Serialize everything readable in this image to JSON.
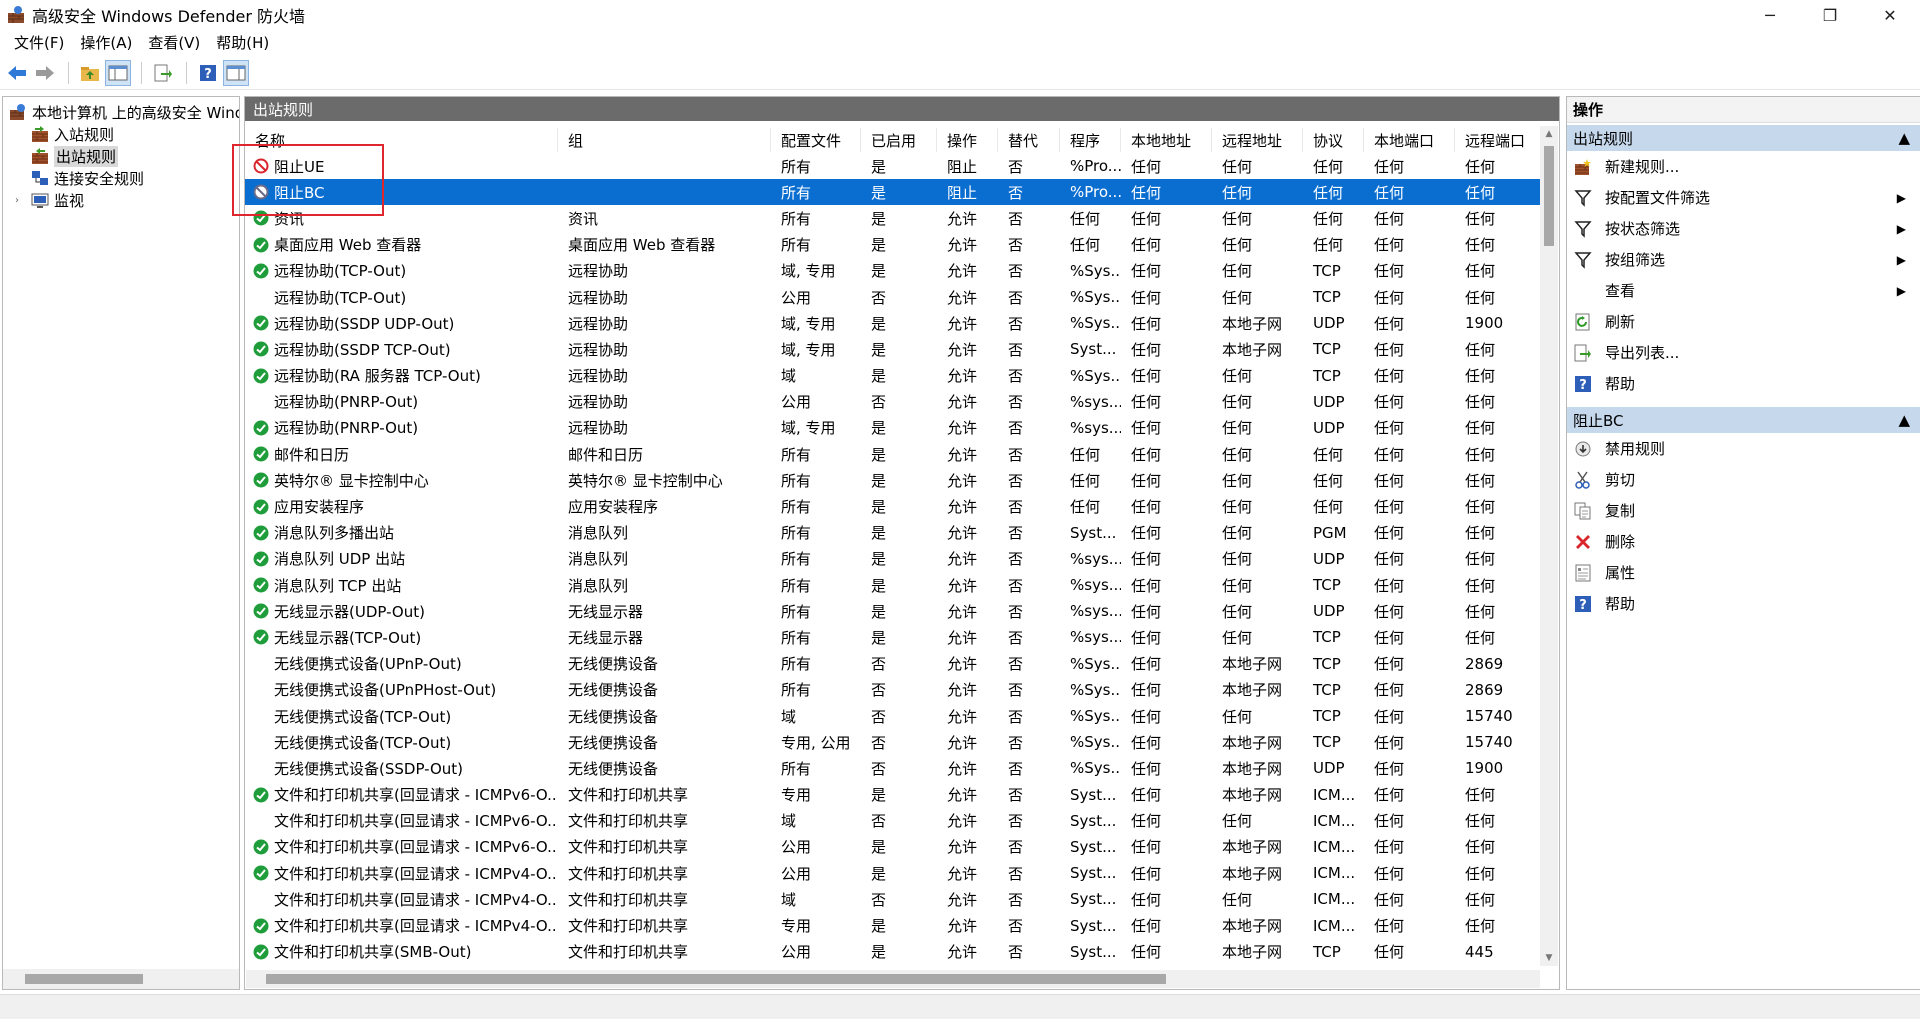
{
  "window": {
    "title": "高级安全 Windows Defender 防火墙",
    "minimize": "─",
    "maximize": "❐",
    "close": "✕"
  },
  "menu": [
    "文件(F)",
    "操作(A)",
    "查看(V)",
    "帮助(H)"
  ],
  "tree": {
    "root": "本地计算机 上的高级安全 Windows Defender 防火墙",
    "items": [
      "入站规则",
      "出站规则",
      "连接安全规则",
      "监视"
    ],
    "selected": "出站规则"
  },
  "main": {
    "section_title": "出站规则",
    "columns": [
      "名称",
      "组",
      "配置文件",
      "已启用",
      "操作",
      "替代",
      "程序",
      "本地地址",
      "远程地址",
      "协议",
      "本地端口",
      "远程端口"
    ],
    "rows": [
      {
        "icon": "block",
        "name": "阻止UE",
        "group": "",
        "profile": "所有",
        "enabled": "是",
        "action": "阻止",
        "override": "否",
        "program": "%Pro...",
        "local": "任何",
        "remote": "任何",
        "protocol": "任何",
        "lport": "任何",
        "rport": "任何"
      },
      {
        "icon": "block-disabled",
        "name": "阻止BC",
        "group": "",
        "profile": "所有",
        "enabled": "是",
        "action": "阻止",
        "override": "否",
        "program": "%Pro...",
        "local": "任何",
        "remote": "任何",
        "protocol": "任何",
        "lport": "任何",
        "rport": "任何",
        "selected": true
      },
      {
        "icon": "allow",
        "name": "资讯",
        "group": "资讯",
        "profile": "所有",
        "enabled": "是",
        "action": "允许",
        "override": "否",
        "program": "任何",
        "local": "任何",
        "remote": "任何",
        "protocol": "任何",
        "lport": "任何",
        "rport": "任何"
      },
      {
        "icon": "allow",
        "name": "桌面应用 Web 查看器",
        "group": "桌面应用 Web 查看器",
        "profile": "所有",
        "enabled": "是",
        "action": "允许",
        "override": "否",
        "program": "任何",
        "local": "任何",
        "remote": "任何",
        "protocol": "任何",
        "lport": "任何",
        "rport": "任何"
      },
      {
        "icon": "allow",
        "name": "远程协助(TCP-Out)",
        "group": "远程协助",
        "profile": "域, 专用",
        "enabled": "是",
        "action": "允许",
        "override": "否",
        "program": "%Sys...",
        "local": "任何",
        "remote": "任何",
        "protocol": "TCP",
        "lport": "任何",
        "rport": "任何"
      },
      {
        "icon": "none",
        "name": "远程协助(TCP-Out)",
        "group": "远程协助",
        "profile": "公用",
        "enabled": "否",
        "action": "允许",
        "override": "否",
        "program": "%Sys...",
        "local": "任何",
        "remote": "任何",
        "protocol": "TCP",
        "lport": "任何",
        "rport": "任何"
      },
      {
        "icon": "allow",
        "name": "远程协助(SSDP UDP-Out)",
        "group": "远程协助",
        "profile": "域, 专用",
        "enabled": "是",
        "action": "允许",
        "override": "否",
        "program": "%Sys...",
        "local": "任何",
        "remote": "本地子网",
        "protocol": "UDP",
        "lport": "任何",
        "rport": "1900"
      },
      {
        "icon": "allow",
        "name": "远程协助(SSDP TCP-Out)",
        "group": "远程协助",
        "profile": "域, 专用",
        "enabled": "是",
        "action": "允许",
        "override": "否",
        "program": "Syst...",
        "local": "任何",
        "remote": "本地子网",
        "protocol": "TCP",
        "lport": "任何",
        "rport": "任何"
      },
      {
        "icon": "allow",
        "name": "远程协助(RA 服务器 TCP-Out)",
        "group": "远程协助",
        "profile": "域",
        "enabled": "是",
        "action": "允许",
        "override": "否",
        "program": "%Sys...",
        "local": "任何",
        "remote": "任何",
        "protocol": "TCP",
        "lport": "任何",
        "rport": "任何"
      },
      {
        "icon": "none",
        "name": "远程协助(PNRP-Out)",
        "group": "远程协助",
        "profile": "公用",
        "enabled": "否",
        "action": "允许",
        "override": "否",
        "program": "%sys...",
        "local": "任何",
        "remote": "任何",
        "protocol": "UDP",
        "lport": "任何",
        "rport": "任何"
      },
      {
        "icon": "allow",
        "name": "远程协助(PNRP-Out)",
        "group": "远程协助",
        "profile": "域, 专用",
        "enabled": "是",
        "action": "允许",
        "override": "否",
        "program": "%sys...",
        "local": "任何",
        "remote": "任何",
        "protocol": "UDP",
        "lport": "任何",
        "rport": "任何"
      },
      {
        "icon": "allow",
        "name": "邮件和日历",
        "group": "邮件和日历",
        "profile": "所有",
        "enabled": "是",
        "action": "允许",
        "override": "否",
        "program": "任何",
        "local": "任何",
        "remote": "任何",
        "protocol": "任何",
        "lport": "任何",
        "rport": "任何"
      },
      {
        "icon": "allow",
        "name": "英特尔® 显卡控制中心",
        "group": "英特尔® 显卡控制中心",
        "profile": "所有",
        "enabled": "是",
        "action": "允许",
        "override": "否",
        "program": "任何",
        "local": "任何",
        "remote": "任何",
        "protocol": "任何",
        "lport": "任何",
        "rport": "任何"
      },
      {
        "icon": "allow",
        "name": "应用安装程序",
        "group": "应用安装程序",
        "profile": "所有",
        "enabled": "是",
        "action": "允许",
        "override": "否",
        "program": "任何",
        "local": "任何",
        "remote": "任何",
        "protocol": "任何",
        "lport": "任何",
        "rport": "任何"
      },
      {
        "icon": "allow",
        "name": "消息队列多播出站",
        "group": "消息队列",
        "profile": "所有",
        "enabled": "是",
        "action": "允许",
        "override": "否",
        "program": "Syst...",
        "local": "任何",
        "remote": "任何",
        "protocol": "PGM",
        "lport": "任何",
        "rport": "任何"
      },
      {
        "icon": "allow",
        "name": "消息队列 UDP 出站",
        "group": "消息队列",
        "profile": "所有",
        "enabled": "是",
        "action": "允许",
        "override": "否",
        "program": "%sys...",
        "local": "任何",
        "remote": "任何",
        "protocol": "UDP",
        "lport": "任何",
        "rport": "任何"
      },
      {
        "icon": "allow",
        "name": "消息队列 TCP 出站",
        "group": "消息队列",
        "profile": "所有",
        "enabled": "是",
        "action": "允许",
        "override": "否",
        "program": "%sys...",
        "local": "任何",
        "remote": "任何",
        "protocol": "TCP",
        "lport": "任何",
        "rport": "任何"
      },
      {
        "icon": "allow",
        "name": "无线显示器(UDP-Out)",
        "group": "无线显示器",
        "profile": "所有",
        "enabled": "是",
        "action": "允许",
        "override": "否",
        "program": "%sys...",
        "local": "任何",
        "remote": "任何",
        "protocol": "UDP",
        "lport": "任何",
        "rport": "任何"
      },
      {
        "icon": "allow",
        "name": "无线显示器(TCP-Out)",
        "group": "无线显示器",
        "profile": "所有",
        "enabled": "是",
        "action": "允许",
        "override": "否",
        "program": "%sys...",
        "local": "任何",
        "remote": "任何",
        "protocol": "TCP",
        "lport": "任何",
        "rport": "任何"
      },
      {
        "icon": "none",
        "name": "无线便携式设备(UPnP-Out)",
        "group": "无线便携设备",
        "profile": "所有",
        "enabled": "否",
        "action": "允许",
        "override": "否",
        "program": "%Sys...",
        "local": "任何",
        "remote": "本地子网",
        "protocol": "TCP",
        "lport": "任何",
        "rport": "2869"
      },
      {
        "icon": "none",
        "name": "无线便携式设备(UPnPHost-Out)",
        "group": "无线便携设备",
        "profile": "所有",
        "enabled": "否",
        "action": "允许",
        "override": "否",
        "program": "%Sys...",
        "local": "任何",
        "remote": "本地子网",
        "protocol": "TCP",
        "lport": "任何",
        "rport": "2869"
      },
      {
        "icon": "none",
        "name": "无线便携式设备(TCP-Out)",
        "group": "无线便携设备",
        "profile": "域",
        "enabled": "否",
        "action": "允许",
        "override": "否",
        "program": "%Sys...",
        "local": "任何",
        "remote": "任何",
        "protocol": "TCP",
        "lport": "任何",
        "rport": "15740"
      },
      {
        "icon": "none",
        "name": "无线便携式设备(TCP-Out)",
        "group": "无线便携设备",
        "profile": "专用, 公用",
        "enabled": "否",
        "action": "允许",
        "override": "否",
        "program": "%Sys...",
        "local": "任何",
        "remote": "本地子网",
        "protocol": "TCP",
        "lport": "任何",
        "rport": "15740"
      },
      {
        "icon": "none",
        "name": "无线便携式设备(SSDP-Out)",
        "group": "无线便携设备",
        "profile": "所有",
        "enabled": "否",
        "action": "允许",
        "override": "否",
        "program": "%Sys...",
        "local": "任何",
        "remote": "本地子网",
        "protocol": "UDP",
        "lport": "任何",
        "rport": "1900"
      },
      {
        "icon": "allow",
        "name": "文件和打印机共享(回显请求 - ICMPv6-O...",
        "group": "文件和打印机共享",
        "profile": "专用",
        "enabled": "是",
        "action": "允许",
        "override": "否",
        "program": "Syst...",
        "local": "任何",
        "remote": "本地子网",
        "protocol": "ICM...",
        "lport": "任何",
        "rport": "任何"
      },
      {
        "icon": "none",
        "name": "文件和打印机共享(回显请求 - ICMPv6-O...",
        "group": "文件和打印机共享",
        "profile": "域",
        "enabled": "否",
        "action": "允许",
        "override": "否",
        "program": "Syst...",
        "local": "任何",
        "remote": "任何",
        "protocol": "ICM...",
        "lport": "任何",
        "rport": "任何"
      },
      {
        "icon": "allow",
        "name": "文件和打印机共享(回显请求 - ICMPv6-O...",
        "group": "文件和打印机共享",
        "profile": "公用",
        "enabled": "是",
        "action": "允许",
        "override": "否",
        "program": "Syst...",
        "local": "任何",
        "remote": "本地子网",
        "protocol": "ICM...",
        "lport": "任何",
        "rport": "任何"
      },
      {
        "icon": "allow",
        "name": "文件和打印机共享(回显请求 - ICMPv4-O...",
        "group": "文件和打印机共享",
        "profile": "公用",
        "enabled": "是",
        "action": "允许",
        "override": "否",
        "program": "Syst...",
        "local": "任何",
        "remote": "本地子网",
        "protocol": "ICM...",
        "lport": "任何",
        "rport": "任何"
      },
      {
        "icon": "none",
        "name": "文件和打印机共享(回显请求 - ICMPv4-O...",
        "group": "文件和打印机共享",
        "profile": "域",
        "enabled": "否",
        "action": "允许",
        "override": "否",
        "program": "Syst...",
        "local": "任何",
        "remote": "任何",
        "protocol": "ICM...",
        "lport": "任何",
        "rport": "任何"
      },
      {
        "icon": "allow",
        "name": "文件和打印机共享(回显请求 - ICMPv4-O...",
        "group": "文件和打印机共享",
        "profile": "专用",
        "enabled": "是",
        "action": "允许",
        "override": "否",
        "program": "Syst...",
        "local": "任何",
        "remote": "本地子网",
        "protocol": "ICM...",
        "lport": "任何",
        "rport": "任何"
      },
      {
        "icon": "allow",
        "name": "文件和打印机共享(SMB-Out)",
        "group": "文件和打印机共享",
        "profile": "公用",
        "enabled": "是",
        "action": "允许",
        "override": "否",
        "program": "Syst...",
        "local": "任何",
        "remote": "本地子网",
        "protocol": "TCP",
        "lport": "任何",
        "rport": "445"
      }
    ]
  },
  "actions": {
    "title": "操作",
    "groups": [
      {
        "title": "出站规则",
        "items": [
          {
            "label": "新建规则...",
            "icon": "new-rule-icon",
            "submenu": false
          },
          {
            "label": "按配置文件筛选",
            "icon": "filter-icon",
            "submenu": true
          },
          {
            "label": "按状态筛选",
            "icon": "filter-icon",
            "submenu": true
          },
          {
            "label": "按组筛选",
            "icon": "filter-icon",
            "submenu": true
          },
          {
            "label": "查看",
            "icon": "",
            "submenu": true
          },
          {
            "label": "刷新",
            "icon": "refresh-icon",
            "submenu": false
          },
          {
            "label": "导出列表...",
            "icon": "export-icon",
            "submenu": false
          },
          {
            "label": "帮助",
            "icon": "help-icon",
            "submenu": false
          }
        ]
      },
      {
        "title": "阻止BC",
        "items": [
          {
            "label": "禁用规则",
            "icon": "disable-icon",
            "submenu": false
          },
          {
            "label": "剪切",
            "icon": "cut-icon",
            "submenu": false
          },
          {
            "label": "复制",
            "icon": "copy-icon",
            "submenu": false
          },
          {
            "label": "删除",
            "icon": "delete-icon",
            "submenu": false
          },
          {
            "label": "属性",
            "icon": "properties-icon",
            "submenu": false
          },
          {
            "label": "帮助",
            "icon": "help-icon",
            "submenu": false
          }
        ]
      }
    ]
  }
}
